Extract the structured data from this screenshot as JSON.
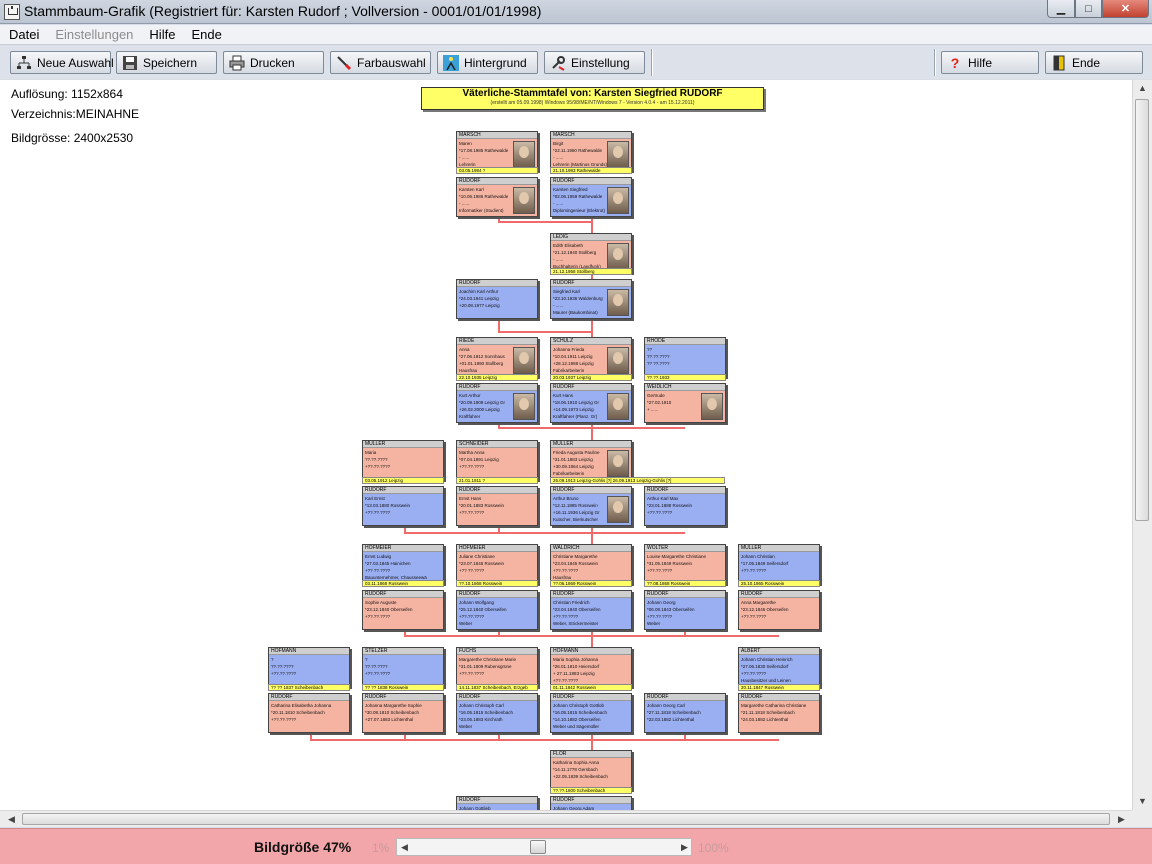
{
  "window": {
    "title": "Stammbaum-Grafik  (Registriert für: Karsten Rudorf ; Vollversion - 0001/01/01/1998)"
  },
  "menu": {
    "items": [
      {
        "label": "Datei",
        "disabled": false
      },
      {
        "label": "Einstellungen",
        "disabled": true
      },
      {
        "label": "Hilfe",
        "disabled": false
      },
      {
        "label": "Ende",
        "disabled": false
      }
    ]
  },
  "toolbar": {
    "neue_auswahl": "Neue Auswahl",
    "speichern": "Speichern",
    "drucken": "Drucken",
    "farbauswahl": "Farbauswahl",
    "hintergrund": "Hintergrund",
    "einstellung": "Einstellung",
    "hilfe": "Hilfe",
    "ende": "Ende"
  },
  "info": {
    "aufloesung": "Auflösung: 1152x864",
    "verzeichnis": "Verzeichnis:MEINAHNE",
    "bildgroesse": "Bildgrösse: 2400x2530"
  },
  "tree": {
    "title": "Väterliche-Stammtafel von: Karsten Siegfried RUDORF",
    "subtitle": "(erstellt am 05.09.1998) Windows 95/98/ME/NT/Windows 7 - Version 4.0.4 - am 15.12.2011)",
    "persons": [
      {
        "surname": "MARSCH",
        "lines": [
          "Maren",
          "*17.08.1985 Rathewalde",
          "- ......",
          "Lehrerin"
        ],
        "sex": "f",
        "photo": true
      },
      {
        "surname": "MARSCH",
        "lines": [
          "Birgit",
          "*22.11.1960 Rathewalde",
          "- ......",
          "Lehrerin (Martinus Grunds)"
        ],
        "sex": "f",
        "photo": true
      },
      {
        "surname": "RUDORF",
        "lines": [
          "Karsten Karl",
          "*10.06.1986 Rathewalde",
          "- ......",
          "Informatiker (Studient)"
        ],
        "sex": "f",
        "photo": true
      },
      {
        "surname": "RUDORF",
        "lines": [
          "Karsten Siegfried",
          "*02.06.1959 Rathewalde",
          "- ......",
          "Diplomingenieur (Elektrot)"
        ],
        "sex": "m",
        "photo": true
      },
      {
        "surname": "LEDIG",
        "lines": [
          "Edith Elisabeth",
          "*21.12.1940 Stollberg",
          "- ......",
          "Buchhalterin (Landfunk)"
        ],
        "sex": "f",
        "photo": true
      },
      {
        "surname": "RUDORF",
        "lines": [
          "Joachim Karl Arthur",
          "*24.03.1941 Leipzig",
          "+20.08.1977 Leipzig"
        ],
        "sex": "m",
        "photo": false
      },
      {
        "surname": "RUDORF",
        "lines": [
          "Siegfried Karl",
          "*23.10.1936 Waldenburg",
          "- ......",
          "Maurer (Baukombinat)"
        ],
        "sex": "m",
        "photo": true
      },
      {
        "surname": "RIEDE",
        "lines": [
          "Anna",
          "*27.06.1912 Sonnhaus",
          "+01.01.1990 Stollberg",
          "Hausfrau"
        ],
        "sex": "f",
        "photo": true
      },
      {
        "surname": "SCHULZ",
        "lines": [
          "Johanna Frieda",
          "*10.04.1911 Leipzig",
          "+28.12.1988 Leipzig",
          "Fabrikarbeiterin"
        ],
        "sex": "f",
        "photo": true
      },
      {
        "surname": "RHODE",
        "lines": [
          "??",
          "??.??.????",
          "?? ??.????"
        ],
        "sex": "m",
        "photo": false
      },
      {
        "surname": "RUDORF",
        "lines": [
          "Kurt Arthur",
          "*20.09.1909 Leipzig Gr",
          "+26.02.2000 Leipzig",
          "Kraftfahrer"
        ],
        "sex": "m",
        "photo": true
      },
      {
        "surname": "RUDORF",
        "lines": [
          "Kurt Hans",
          "*18.06.1910 Leipzig Gr",
          "+14.09.1973 Leipzig",
          "Kraftfahrer (Planz. Gr)"
        ],
        "sex": "m",
        "photo": true
      },
      {
        "surname": "WEIDLICH",
        "lines": [
          "Gertrude",
          "*27.02.1910",
          "+ ......"
        ],
        "sex": "f",
        "photo": true
      },
      {
        "surname": "MÜLLER",
        "lines": [
          "Maria",
          "??.??.????",
          "+??.??.????"
        ],
        "sex": "f",
        "photo": false
      },
      {
        "surname": "SCHNEIDER",
        "lines": [
          "Martha Anna",
          "*07.04.1891 Leipzig",
          "+??.??.????"
        ],
        "sex": "f",
        "photo": false
      },
      {
        "surname": "MÜLLER",
        "lines": [
          "Frieda Augusta Pauline",
          "*31.01.1883 Leipzig",
          "+30.09.1964 Leipzig",
          "Fabrikarbeiterin"
        ],
        "sex": "f",
        "photo": true
      },
      {
        "surname": "RUDORF",
        "lines": [
          "Karl Ernst",
          "*13.03.1880 Rosswein",
          "+??.??.????"
        ],
        "sex": "m",
        "photo": false
      },
      {
        "surname": "RUDORF",
        "lines": [
          "Ernst Hans",
          "*20.01.1883 Rosswein",
          "+??.??.????"
        ],
        "sex": "f",
        "photo": false
      },
      {
        "surname": "RUDORF",
        "lines": [
          "Arthur Bruno",
          "*12.11.1885 Rosswein",
          "+16.11.1936 Leipzig Gr",
          "Kutscher, Bierkutscher"
        ],
        "sex": "m",
        "photo": true
      },
      {
        "surname": "RUDORF",
        "lines": [
          "Arthur Karl Max",
          "*23.01.1888 Rosswein",
          "+??.??.????"
        ],
        "sex": "m",
        "photo": false
      },
      {
        "surname": "HOFMEIER",
        "lines": [
          "Ernst Ludwig",
          "*27.03.1845 Hainichen",
          "+?? ??.????",
          "Bauunternehmer, Chausseewä"
        ],
        "sex": "m",
        "photo": false
      },
      {
        "surname": "HOFMEIER",
        "lines": [
          "Juliane Christiane",
          "*23.07.1845 Rosswein",
          "+?? ??.????"
        ],
        "sex": "f",
        "photo": false
      },
      {
        "surname": "WALDRICH",
        "lines": [
          "Christiane Margarethe",
          "*23.04.1845 Rosswein",
          "+??.??.????",
          "Hausfrau"
        ],
        "sex": "f",
        "photo": false
      },
      {
        "surname": "WOLTER",
        "lines": [
          "Louise Margarethe Christiane",
          "*31.05.1849 Rosswein",
          "+??.??.????"
        ],
        "sex": "f",
        "photo": false
      },
      {
        "surname": "MÜLLER",
        "lines": [
          "Johann Christian",
          "*17.05.1849 Seifersdorf",
          "+??.??.????"
        ],
        "sex": "m",
        "photo": false
      },
      {
        "surname": "RUDORF",
        "lines": [
          "Sophie Auguste",
          "*23.12.1840 Oberseifen",
          "+??.??.????"
        ],
        "sex": "f",
        "photo": false
      },
      {
        "surname": "RUDORF",
        "lines": [
          "Johann Wolfgang",
          "*25.12.1840 Oberseifen",
          "+??.??.????",
          "Weber"
        ],
        "sex": "m",
        "photo": false
      },
      {
        "surname": "RUDORF",
        "lines": [
          "Christian Friedrich",
          "*23.04.1840 Oberseifen",
          "+??.??.????",
          "Weber, Strickermeister"
        ],
        "sex": "m",
        "photo": false
      },
      {
        "surname": "RUDORF",
        "lines": [
          "Johann Georg",
          "*06.08.1843 Oberseifen",
          "+??.??.????",
          "Weber"
        ],
        "sex": "m",
        "photo": false
      },
      {
        "surname": "RUDORF",
        "lines": [
          "Anna Margarethe",
          "*23.12.1846 Oberseifen",
          "+??.??.????"
        ],
        "sex": "f",
        "photo": false
      },
      {
        "surname": "HOFMANN",
        "lines": [
          "?",
          "??.??.????",
          "+??.??.????"
        ],
        "sex": "m",
        "photo": false
      },
      {
        "surname": "STELZER",
        "lines": [
          "?",
          "??.??.????",
          "+??.??.????"
        ],
        "sex": "m",
        "photo": false
      },
      {
        "surname": "FUCHS",
        "lines": [
          "Margarethe Christiane Marie",
          "*31.01.1809 Rubensgrüne",
          "+??.??.????"
        ],
        "sex": "f",
        "photo": false
      },
      {
        "surname": "HOFMANN",
        "lines": [
          "Maria Sophia Johanna",
          "*26.01.1810 Heiersdorf",
          "+ 27.11.1883 Leipzig",
          "+??.??.????"
        ],
        "sex": "f",
        "photo": false
      },
      {
        "surname": "ALBERT",
        "lines": [
          "Johann Christian Heinrich",
          "*27.06.1830 Seifersdorf",
          "+??.??.????",
          "Hausbesitzer und Leinen"
        ],
        "sex": "m",
        "photo": false
      },
      {
        "surname": "RUDORF",
        "lines": [
          "Catharina Elisabetha Johanna",
          "*20.11.1810 Scheibenbach",
          "+??.??.????"
        ],
        "sex": "f",
        "photo": false
      },
      {
        "surname": "RUDORF",
        "lines": [
          "Johanna Margarethe Sophie",
          "*30.08.1810 Scheibenbach",
          "+27.07.1883 Lichtenthal"
        ],
        "sex": "f",
        "photo": false
      },
      {
        "surname": "RUDORF",
        "lines": [
          "Johann Christoph Carl",
          "*16.05.1815 Scheibenbach",
          "*23.06.1883 Kirchrath",
          "Weber"
        ],
        "sex": "m",
        "photo": false
      },
      {
        "surname": "RUDORF",
        "lines": [
          "Johann Christoph Gottlob",
          "*16.05.1815 Scheibenbach",
          "*14.10.1882 Oberseifen",
          "Weber und Sägemüller"
        ],
        "sex": "m",
        "photo": false
      },
      {
        "surname": "RUDORF",
        "lines": [
          "Johann Georg Carl",
          "*27.11.1818 Scheibenbach",
          "*22.03.1882 Lichtenthal"
        ],
        "sex": "m",
        "photo": false
      },
      {
        "surname": "RUDORF",
        "lines": [
          "Margarethe Catharina Christiane",
          "*21.11.1818 Scheibenbach",
          "*24.03.1882 Lichtenthal"
        ],
        "sex": "f",
        "photo": false
      },
      {
        "surname": "FLOR",
        "lines": [
          "Katharina Sophia Anna",
          "*14.11.1778 Gersbach",
          "+22.05.1839 Scheibenbach"
        ],
        "sex": "f",
        "photo": false
      },
      {
        "surname": "RUDORF",
        "lines": [
          "Johann Gottlieb"
        ],
        "sex": "m",
        "photo": false
      },
      {
        "surname": "RUDORF",
        "lines": [
          "Johann Georg Adam"
        ],
        "sex": "m",
        "photo": false
      }
    ],
    "marriages": [
      "03.05.1984 ?",
      "21.10.1983 Rathewalde",
      "21.12.1958 Stollberg",
      "22.10.1935 Leipzig",
      "20.03.1937 Leipzig",
      "??.??.1933",
      "03.05.1912 Leipzig",
      "21.01.1911 ?",
      "26.09.1913 Leipzig-Gohlis [?] 26.09.1913 Leipzig-Gohlis [?]",
      "03.11.1868 Rosswein",
      "??.10.1868 Rosswein",
      "??.06.1869 Rosswein",
      "??.08.1868 Rosswein",
      "25.10.1865 Rosswein",
      "?? ?? 1837 Scheibenbach",
      "?? ?? 1838 Rosswein",
      "14.11.1837 Scheibenbach, Erzgeb",
      "01.11.1842 Rosswein",
      "20.11.1847 Rosswein",
      "??.??.1800 Scheibenbach"
    ]
  },
  "scroll": {
    "h_arrow_left": "◀",
    "h_arrow_right": "▶",
    "v_arrow_up": "▲",
    "v_arrow_down": "▼"
  },
  "zoom": {
    "label": "Bildgröße 47%",
    "min": "1%",
    "max": "100%",
    "value": 0.47
  }
}
